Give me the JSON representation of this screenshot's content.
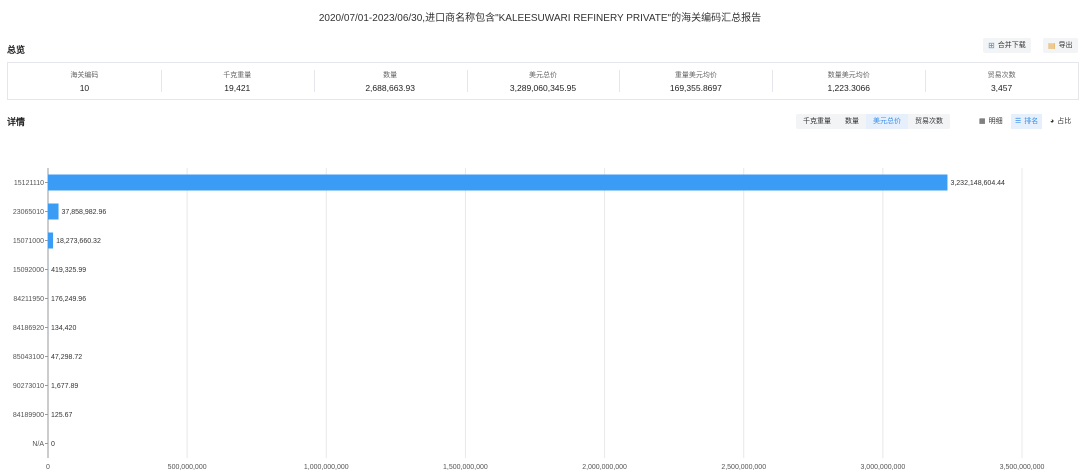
{
  "title": "2020/07/01-2023/06/30,进口商名称包含\"KALEESUWARI REFINERY PRIVATE\"的海关编码汇总报告",
  "overview": {
    "label": "总览",
    "merge_download": "合并下载",
    "export": "导出",
    "stats": [
      {
        "label": "海关编码",
        "value": "10"
      },
      {
        "label": "千克重量",
        "value": "19,421"
      },
      {
        "label": "数量",
        "value": "2,688,663.93"
      },
      {
        "label": "美元总价",
        "value": "3,289,060,345.95"
      },
      {
        "label": "重量美元均价",
        "value": "169,355.8697"
      },
      {
        "label": "数量美元均价",
        "value": "1,223.3066"
      },
      {
        "label": "贸易次数",
        "value": "3,457"
      }
    ]
  },
  "details": {
    "label": "详情",
    "metric_tabs": [
      "千克重量",
      "数量",
      "美元总价",
      "贸易次数"
    ],
    "active_metric": "美元总价",
    "view_buttons": {
      "detail": "明细",
      "rank": "排名",
      "ratio": "占比"
    },
    "active_view": "排名"
  },
  "colors": {
    "bar": "#3b9cf5",
    "accent": "#3a8ee6",
    "grid": "#e8e8e8"
  },
  "chart_data": {
    "type": "bar",
    "orientation": "horizontal",
    "categories": [
      "15121110",
      "23065010",
      "15071000",
      "15092000",
      "84211950",
      "84186920",
      "85043100",
      "90273010",
      "84189900",
      "N/A"
    ],
    "values": [
      3232148604.44,
      37858982.96,
      18273660.32,
      419325.99,
      176249.96,
      134420,
      47298.72,
      1677.89,
      125.67,
      0
    ],
    "value_labels": [
      "3,232,148,604.44",
      "37,858,982.96",
      "18,273,660.32",
      "419,325.99",
      "176,249.96",
      "134,420",
      "47,298.72",
      "1,677.89",
      "125.67",
      "0"
    ],
    "xlim": [
      0,
      3500000000
    ],
    "x_ticks": [
      0,
      500000000,
      1000000000,
      1500000000,
      2000000000,
      2500000000,
      3000000000,
      3500000000
    ],
    "x_tick_labels": [
      "0",
      "500,000,000",
      "1,000,000,000",
      "1,500,000,000",
      "2,000,000,000",
      "2,500,000,000",
      "3,000,000,000",
      "3,500,000,000"
    ],
    "grid": true
  }
}
